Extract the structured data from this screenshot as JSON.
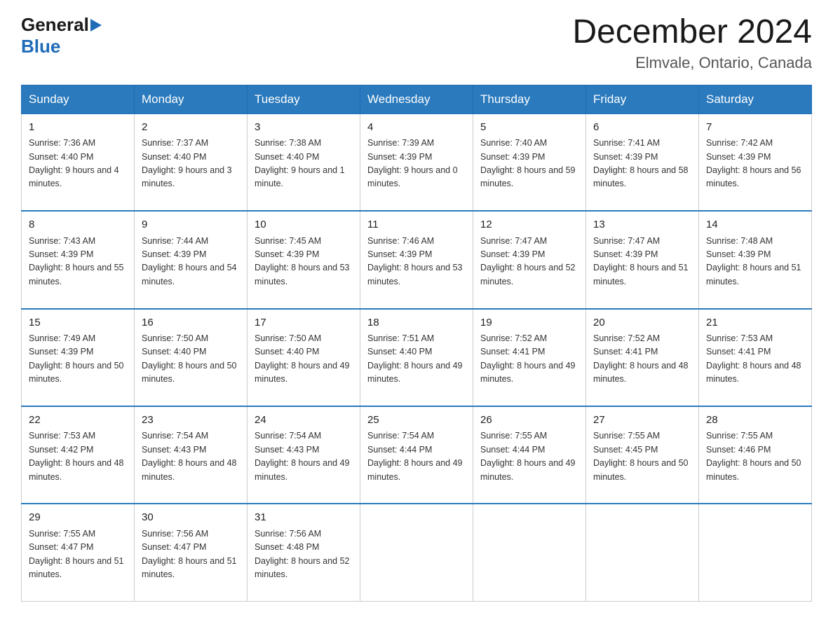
{
  "logo": {
    "general": "General",
    "blue": "Blue"
  },
  "title": "December 2024",
  "location": "Elmvale, Ontario, Canada",
  "days_header": [
    "Sunday",
    "Monday",
    "Tuesday",
    "Wednesday",
    "Thursday",
    "Friday",
    "Saturday"
  ],
  "weeks": [
    [
      {
        "day": "1",
        "sunrise": "7:36 AM",
        "sunset": "4:40 PM",
        "daylight": "9 hours and 4 minutes."
      },
      {
        "day": "2",
        "sunrise": "7:37 AM",
        "sunset": "4:40 PM",
        "daylight": "9 hours and 3 minutes."
      },
      {
        "day": "3",
        "sunrise": "7:38 AM",
        "sunset": "4:40 PM",
        "daylight": "9 hours and 1 minute."
      },
      {
        "day": "4",
        "sunrise": "7:39 AM",
        "sunset": "4:39 PM",
        "daylight": "9 hours and 0 minutes."
      },
      {
        "day": "5",
        "sunrise": "7:40 AM",
        "sunset": "4:39 PM",
        "daylight": "8 hours and 59 minutes."
      },
      {
        "day": "6",
        "sunrise": "7:41 AM",
        "sunset": "4:39 PM",
        "daylight": "8 hours and 58 minutes."
      },
      {
        "day": "7",
        "sunrise": "7:42 AM",
        "sunset": "4:39 PM",
        "daylight": "8 hours and 56 minutes."
      }
    ],
    [
      {
        "day": "8",
        "sunrise": "7:43 AM",
        "sunset": "4:39 PM",
        "daylight": "8 hours and 55 minutes."
      },
      {
        "day": "9",
        "sunrise": "7:44 AM",
        "sunset": "4:39 PM",
        "daylight": "8 hours and 54 minutes."
      },
      {
        "day": "10",
        "sunrise": "7:45 AM",
        "sunset": "4:39 PM",
        "daylight": "8 hours and 53 minutes."
      },
      {
        "day": "11",
        "sunrise": "7:46 AM",
        "sunset": "4:39 PM",
        "daylight": "8 hours and 53 minutes."
      },
      {
        "day": "12",
        "sunrise": "7:47 AM",
        "sunset": "4:39 PM",
        "daylight": "8 hours and 52 minutes."
      },
      {
        "day": "13",
        "sunrise": "7:47 AM",
        "sunset": "4:39 PM",
        "daylight": "8 hours and 51 minutes."
      },
      {
        "day": "14",
        "sunrise": "7:48 AM",
        "sunset": "4:39 PM",
        "daylight": "8 hours and 51 minutes."
      }
    ],
    [
      {
        "day": "15",
        "sunrise": "7:49 AM",
        "sunset": "4:39 PM",
        "daylight": "8 hours and 50 minutes."
      },
      {
        "day": "16",
        "sunrise": "7:50 AM",
        "sunset": "4:40 PM",
        "daylight": "8 hours and 50 minutes."
      },
      {
        "day": "17",
        "sunrise": "7:50 AM",
        "sunset": "4:40 PM",
        "daylight": "8 hours and 49 minutes."
      },
      {
        "day": "18",
        "sunrise": "7:51 AM",
        "sunset": "4:40 PM",
        "daylight": "8 hours and 49 minutes."
      },
      {
        "day": "19",
        "sunrise": "7:52 AM",
        "sunset": "4:41 PM",
        "daylight": "8 hours and 49 minutes."
      },
      {
        "day": "20",
        "sunrise": "7:52 AM",
        "sunset": "4:41 PM",
        "daylight": "8 hours and 48 minutes."
      },
      {
        "day": "21",
        "sunrise": "7:53 AM",
        "sunset": "4:41 PM",
        "daylight": "8 hours and 48 minutes."
      }
    ],
    [
      {
        "day": "22",
        "sunrise": "7:53 AM",
        "sunset": "4:42 PM",
        "daylight": "8 hours and 48 minutes."
      },
      {
        "day": "23",
        "sunrise": "7:54 AM",
        "sunset": "4:43 PM",
        "daylight": "8 hours and 48 minutes."
      },
      {
        "day": "24",
        "sunrise": "7:54 AM",
        "sunset": "4:43 PM",
        "daylight": "8 hours and 49 minutes."
      },
      {
        "day": "25",
        "sunrise": "7:54 AM",
        "sunset": "4:44 PM",
        "daylight": "8 hours and 49 minutes."
      },
      {
        "day": "26",
        "sunrise": "7:55 AM",
        "sunset": "4:44 PM",
        "daylight": "8 hours and 49 minutes."
      },
      {
        "day": "27",
        "sunrise": "7:55 AM",
        "sunset": "4:45 PM",
        "daylight": "8 hours and 50 minutes."
      },
      {
        "day": "28",
        "sunrise": "7:55 AM",
        "sunset": "4:46 PM",
        "daylight": "8 hours and 50 minutes."
      }
    ],
    [
      {
        "day": "29",
        "sunrise": "7:55 AM",
        "sunset": "4:47 PM",
        "daylight": "8 hours and 51 minutes."
      },
      {
        "day": "30",
        "sunrise": "7:56 AM",
        "sunset": "4:47 PM",
        "daylight": "8 hours and 51 minutes."
      },
      {
        "day": "31",
        "sunrise": "7:56 AM",
        "sunset": "4:48 PM",
        "daylight": "8 hours and 52 minutes."
      },
      null,
      null,
      null,
      null
    ]
  ],
  "labels": {
    "sunrise": "Sunrise:",
    "sunset": "Sunset:",
    "daylight": "Daylight:"
  }
}
